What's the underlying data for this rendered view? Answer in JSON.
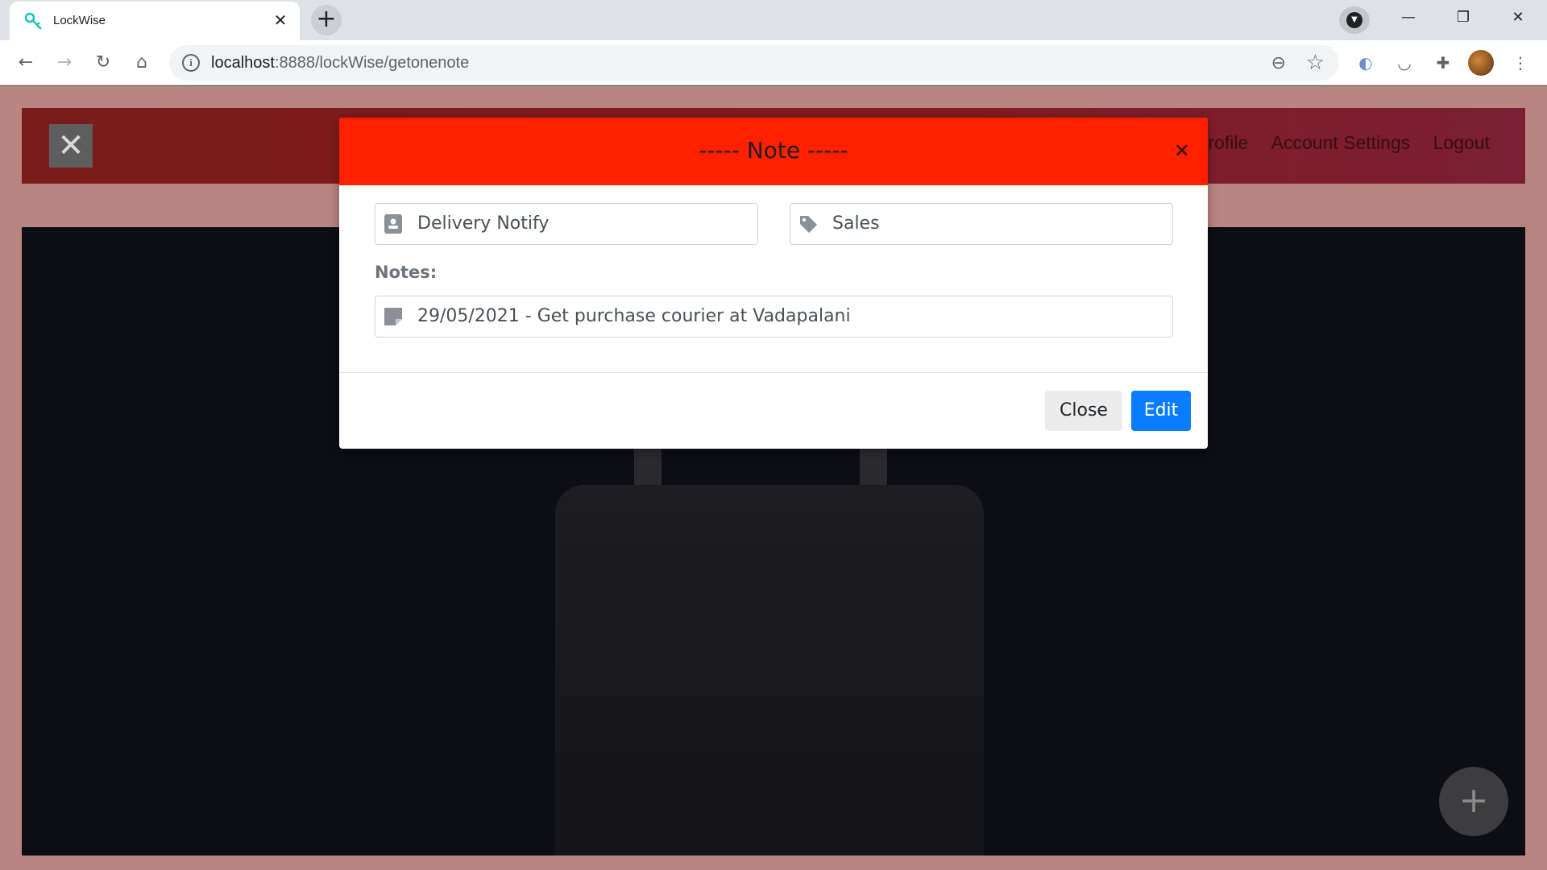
{
  "browser": {
    "tab_title": "LockWise",
    "tab_close": "✕",
    "new_tab": "+",
    "url_host": "localhost",
    "url_path": ":8888/lockWise/getonenote",
    "window_controls": {
      "minimize": "—",
      "restore": "❐",
      "close": "✕"
    }
  },
  "site": {
    "menu_close": "✕",
    "nav_links": [
      "rofile",
      "Account Settings",
      "Logout"
    ],
    "fab_label": "+"
  },
  "modal": {
    "title": "----- Note -----",
    "close_x": "×",
    "title_field": {
      "value": "Delivery Notify",
      "icon": "contact-card-icon"
    },
    "category_field": {
      "value": "Sales",
      "icon": "tag-icon"
    },
    "notes_label": "Notes:",
    "notes_field": {
      "value": "29/05/2021 - Get purchase courier at Vadapalani",
      "icon": "sticky-note-icon"
    },
    "close_button": "Close",
    "edit_button": "Edit"
  },
  "colors": {
    "modal_header": "#ff2000",
    "edit_button": "#0a7cff",
    "header_bar": "#831c22"
  }
}
